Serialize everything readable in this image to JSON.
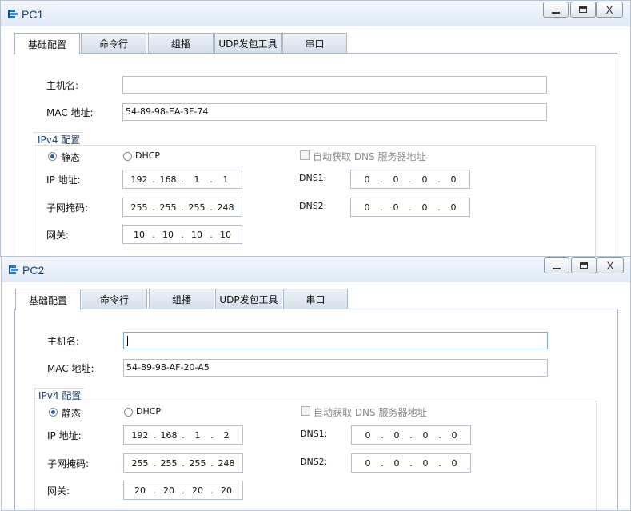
{
  "tabs": [
    "基础配置",
    "命令行",
    "组播",
    "UDP发包工具",
    "串口"
  ],
  "labels": {
    "hostname": "主机名:",
    "mac": "MAC 地址:",
    "ipv4_group": "IPv4 配置",
    "static": "静态",
    "dhcp": "DHCP",
    "auto_dns": "自动获取 DNS 服务器地址",
    "ip": "IP 地址:",
    "mask": "子网掩码:",
    "gateway": "网关:",
    "dns1": "DNS1:",
    "dns2": "DNS2:"
  },
  "window_buttons": {
    "minimize": "minimize-icon",
    "maximize": "maximize-icon",
    "close": "X"
  },
  "pc1": {
    "title": "PC1",
    "hostname": "",
    "mac": "54-89-98-EA-3F-74",
    "ip": [
      "192",
      "168",
      "1",
      "1"
    ],
    "mask": [
      "255",
      "255",
      "255",
      "248"
    ],
    "gateway": [
      "10",
      "10",
      "10",
      "10"
    ],
    "dns1": [
      "0",
      "0",
      "0",
      "0"
    ],
    "dns2": [
      "0",
      "0",
      "0",
      "0"
    ],
    "mode": "static"
  },
  "pc2": {
    "title": "PC2",
    "hostname": "",
    "mac": "54-89-98-AF-20-A5",
    "ip": [
      "192",
      "168",
      "1",
      "2"
    ],
    "mask": [
      "255",
      "255",
      "255",
      "248"
    ],
    "gateway": [
      "20",
      "20",
      "20",
      "20"
    ],
    "dns1": [
      "0",
      "0",
      "0",
      "0"
    ],
    "dns2": [
      "0",
      "0",
      "0",
      "0"
    ],
    "mode": "static"
  },
  "colors": {
    "accent": "#1f3f6b",
    "tab_bg": "#d4deea",
    "border": "#aab4c3"
  }
}
